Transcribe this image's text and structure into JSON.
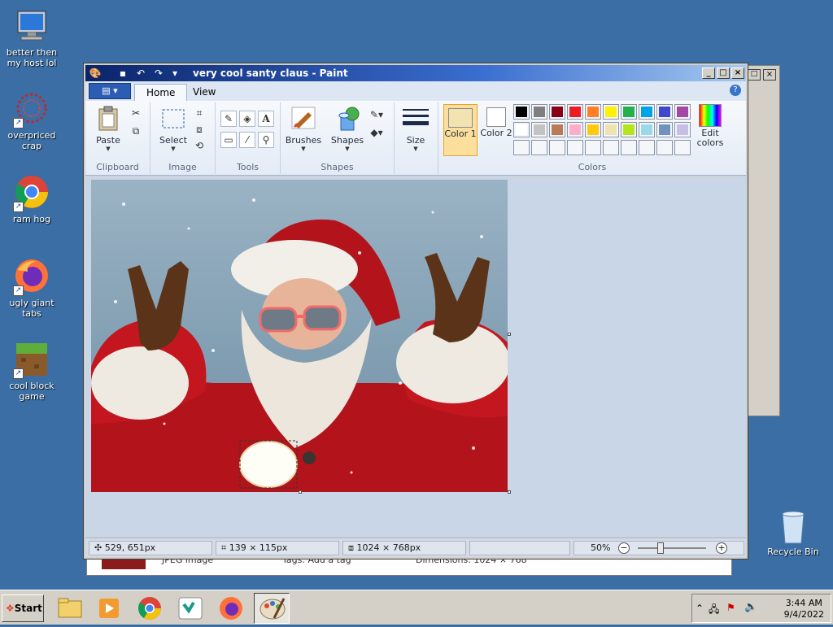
{
  "desktop": {
    "icons": [
      {
        "label": "better then my host lol",
        "icon": "computer-icon"
      },
      {
        "label": "overpriced crap",
        "icon": "swirl-icon"
      },
      {
        "label": "ram hog",
        "icon": "chrome-icon"
      },
      {
        "label": "ugly giant tabs",
        "icon": "firefox-icon"
      },
      {
        "label": "cool block game",
        "icon": "minecraft-icon"
      }
    ],
    "recycle_bin": "Recycle Bin"
  },
  "background_window": {
    "row_type": "JPEG image",
    "tags": "Tags: Add a tag",
    "dimensions": "Dimensions: 1024 × 768"
  },
  "paint": {
    "title": "very cool santy claus - Paint",
    "tabs": [
      "Home",
      "View"
    ],
    "groups": {
      "clipboard": {
        "label": "Clipboard",
        "paste": "Paste"
      },
      "image": {
        "label": "Image",
        "select": "Select"
      },
      "tools": {
        "label": "Tools"
      },
      "shapes": {
        "label": "Shapes",
        "brushes": "Brushes",
        "shapes": "Shapes"
      },
      "size": {
        "label": "Size"
      },
      "colors": {
        "label": "Colors",
        "color1": "Color 1",
        "color2": "Color 2",
        "edit": "Edit colors"
      }
    },
    "color1": "#f3e3b0",
    "color2": "#ffffff",
    "palette_row1": [
      "#000000",
      "#7f7f7f",
      "#880015",
      "#ed1c24",
      "#ff7f27",
      "#fff200",
      "#22b14c",
      "#00a2e8",
      "#3f48cc",
      "#a349a4"
    ],
    "palette_row2": [
      "#ffffff",
      "#c3c3c3",
      "#b97a57",
      "#ffaec9",
      "#ffc90e",
      "#efe4b0",
      "#b5e61d",
      "#99d9ea",
      "#7092be",
      "#c8bfe7"
    ],
    "status": {
      "cursor": "529, 651px",
      "selection": "139 × 115px",
      "size": "1024 × 768px",
      "zoom": "50%"
    },
    "zoom_level": 0.5
  },
  "taskbar": {
    "start": "Start",
    "time": "3:44 AM",
    "date": "9/4/2022",
    "apps": [
      "explorer",
      "media",
      "chrome",
      "vscode",
      "firefox",
      "paint"
    ]
  }
}
